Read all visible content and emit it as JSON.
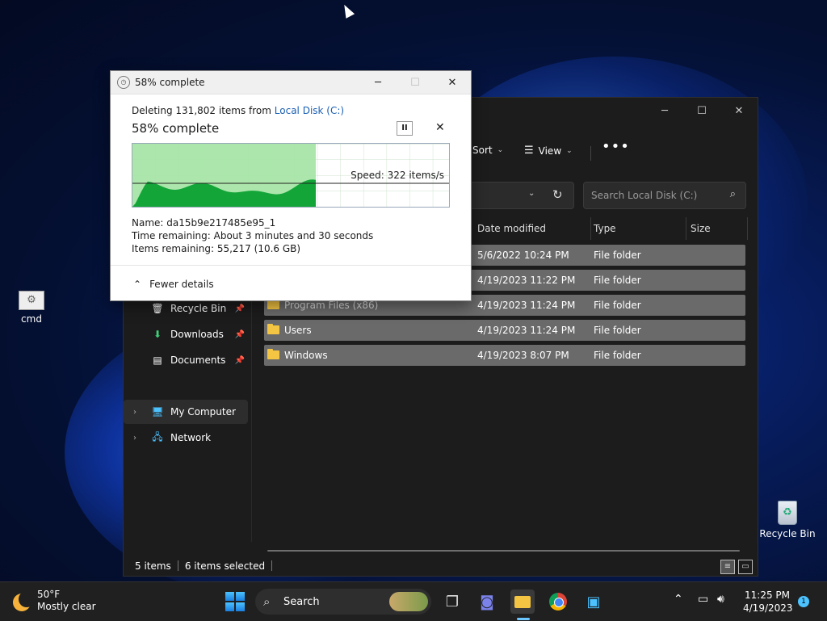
{
  "desktop": {
    "icons": [
      {
        "label": "cmd"
      },
      {
        "label": "Recycle Bin"
      }
    ]
  },
  "explorer": {
    "toolbar": {
      "sort_label": "Sort",
      "view_label": "View",
      "more_label": "•••"
    },
    "search": {
      "placeholder": "Search Local Disk (C:)"
    },
    "columns": [
      "Date modified",
      "Type",
      "Size"
    ],
    "nav": [
      {
        "label": "Recycle Bin"
      },
      {
        "label": "Downloads"
      },
      {
        "label": "Documents"
      },
      {
        "label": "My Computer"
      },
      {
        "label": "Network"
      }
    ],
    "rows": [
      {
        "name": "",
        "date": "5/6/2022 10:24 PM",
        "type": "File folder"
      },
      {
        "name": "",
        "date": "4/19/2023 11:22 PM",
        "type": "File folder"
      },
      {
        "name": "Program Files (x86)",
        "date": "4/19/2023 11:24 PM",
        "type": "File folder"
      },
      {
        "name": "Users",
        "date": "4/19/2023 11:24 PM",
        "type": "File folder"
      },
      {
        "name": "Windows",
        "date": "4/19/2023 8:07 PM",
        "type": "File folder"
      }
    ],
    "status": {
      "items": "5 items",
      "selected": "6 items selected"
    }
  },
  "dialog": {
    "title": "58% complete",
    "deleting_prefix": "Deleting 131,802 items from ",
    "deleting_link": "Local Disk (C:)",
    "percent_label": "58% complete",
    "progress_fraction": 0.58,
    "speed": "Speed: 322 items/s",
    "name_line": "Name:  da15b9e217485e95_1",
    "time_line": "Time remaining:  About 3 minutes and 30 seconds",
    "items_line": "Items remaining:  55,217 (10.6 GB)",
    "fewer_details": "Fewer details"
  },
  "taskbar": {
    "weather_temp": "50°F",
    "weather_desc": "Mostly clear",
    "search_label": "Search",
    "time": "11:25 PM",
    "date": "4/19/2023",
    "notification_count": "1"
  },
  "colors": {
    "accent": "#4cc2ff",
    "progress_green": "#13a538",
    "row_selected": "#6a6a6a",
    "folder": "#f4c542"
  }
}
